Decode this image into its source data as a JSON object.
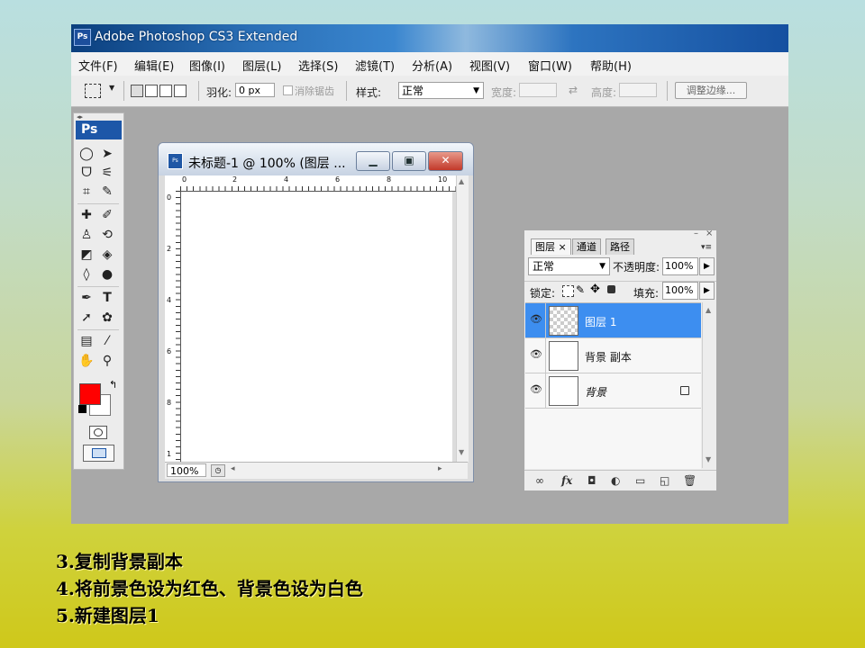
{
  "window": {
    "app_icon": "Ps",
    "title": "Adobe Photoshop CS3 Extended"
  },
  "menu": [
    "文件(F)",
    "编辑(E)",
    "图像(I)",
    "图层(L)",
    "选择(S)",
    "滤镜(T)",
    "分析(A)",
    "视图(V)",
    "窗口(W)",
    "帮助(H)"
  ],
  "options": {
    "feather_label": "羽化:",
    "feather_value": "0 px",
    "antialias_label": "消除锯齿",
    "style_label": "样式:",
    "style_value": "正常",
    "width_label": "宽度:",
    "height_label": "高度:",
    "refine_edge_button": "调整边缘..."
  },
  "toolbox": {
    "header": "Ps",
    "foreground_color": "#ff0000",
    "background_color": "#ffffff"
  },
  "document": {
    "title": "未标题-1 @ 100% (图层 ...",
    "zoom": "100%",
    "ruler_h": [
      "0",
      "2",
      "4",
      "6",
      "8",
      "10"
    ],
    "ruler_v": [
      "0",
      "2",
      "4",
      "6",
      "8",
      "1"
    ]
  },
  "layers_panel": {
    "tabs": [
      "图层",
      "通道",
      "路径"
    ],
    "blend_mode": "正常",
    "opacity_label": "不透明度:",
    "opacity_value": "100%",
    "lock_label": "锁定:",
    "fill_label": "填充:",
    "fill_value": "100%",
    "layers": [
      {
        "name": "图层 1",
        "selected": true,
        "visible": true,
        "transparent": true
      },
      {
        "name": "背景 副本",
        "selected": false,
        "visible": true,
        "transparent": false
      },
      {
        "name": "背景",
        "selected": false,
        "visible": true,
        "transparent": false,
        "locked": true
      }
    ],
    "bottom_buttons": [
      "link-icon",
      "fx-icon",
      "mask-icon",
      "adjustment-icon",
      "group-folder-icon",
      "new-layer-icon",
      "trash-icon"
    ],
    "fx_label": "fx"
  },
  "captions": [
    "3.复制背景副本",
    "4.将前景色设为红色、背景色设为白色",
    "5.新建图层1"
  ]
}
